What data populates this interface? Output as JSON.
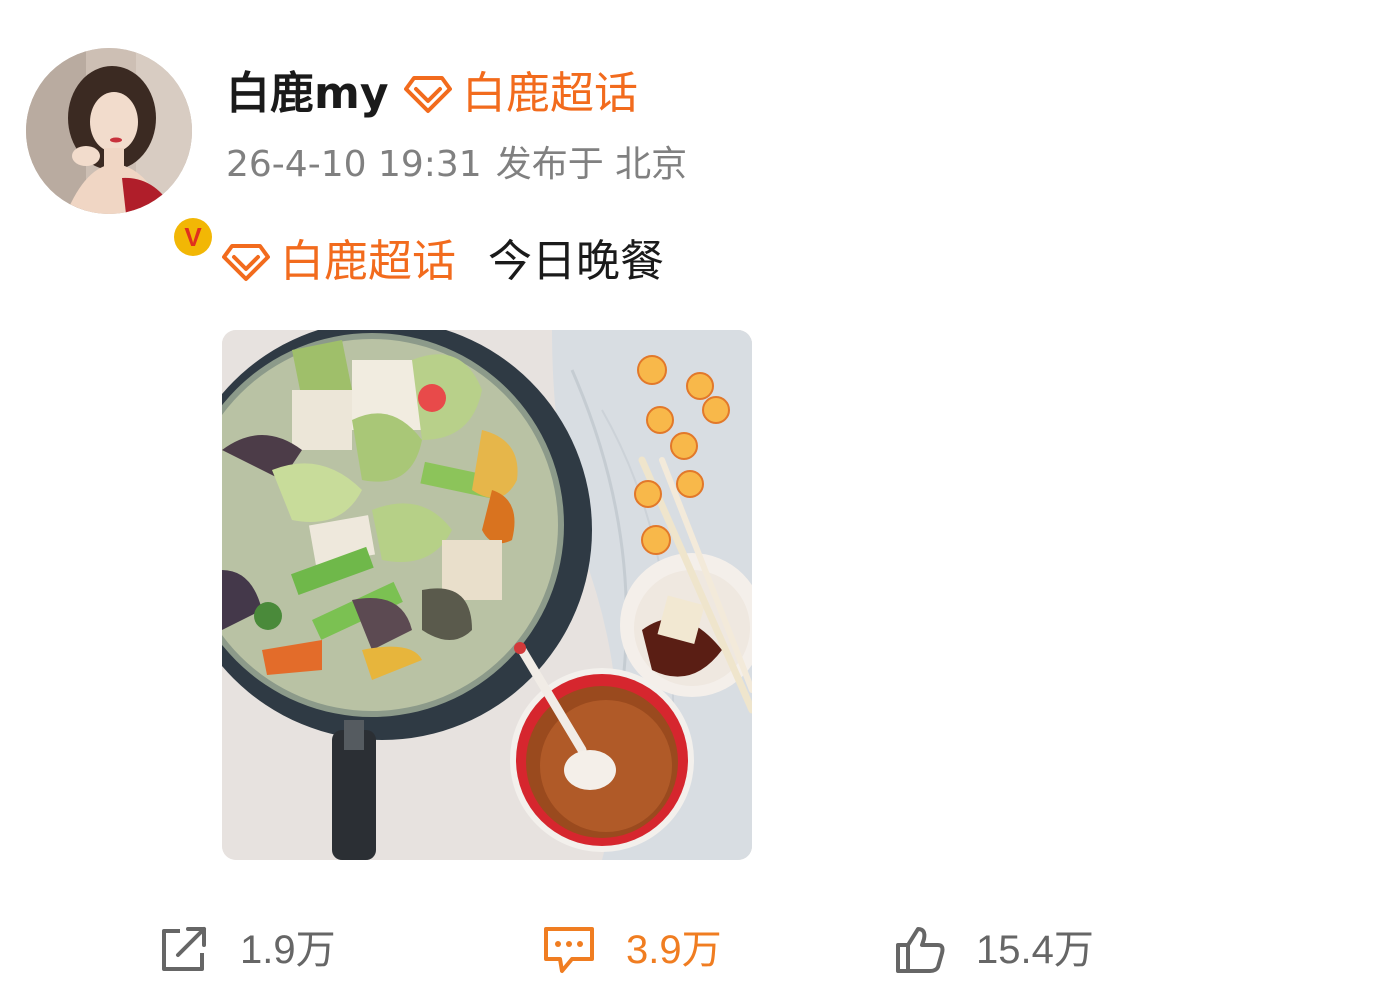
{
  "user": {
    "name": "白鹿my",
    "verified": true,
    "supertopic": "白鹿超话"
  },
  "post": {
    "date": "26-4-10 19:31",
    "location": "发布于 北京",
    "topic": "白鹿超话",
    "text": "今日晚餐",
    "image_description_icon": "food-photo"
  },
  "actions": {
    "share_count": "1.9万",
    "comment_count": "3.9万",
    "like_count": "15.4万"
  },
  "colors": {
    "accent_orange": "#f26b1d",
    "comment_orange": "#f07d21",
    "muted_text": "#808080",
    "verified_gold": "#f2b705"
  },
  "icons": [
    "supertopic-diamond-icon",
    "share-icon",
    "comment-icon",
    "like-icon",
    "verified-icon"
  ]
}
